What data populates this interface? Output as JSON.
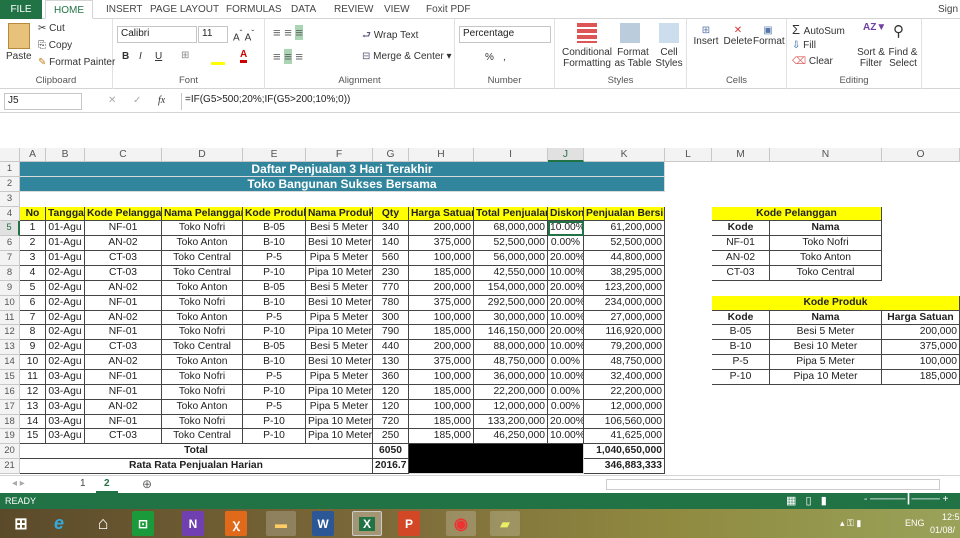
{
  "ribbon": {
    "tabs": [
      "FILE",
      "HOME",
      "INSERT",
      "PAGE LAYOUT",
      "FORMULAS",
      "DATA",
      "REVIEW",
      "VIEW",
      "Foxit PDF"
    ],
    "signin": "Sign",
    "clipboard": {
      "paste": "Paste",
      "cut": "Cut",
      "copy": "Copy",
      "format_painter": "Format Painter",
      "label": "Clipboard"
    },
    "font": {
      "name": "Calibri",
      "size": "11",
      "bold": "B",
      "italic": "I",
      "underline": "U",
      "label": "Font"
    },
    "alignment": {
      "wrap": "Wrap Text",
      "merge": "Merge & Center",
      "label": "Alignment"
    },
    "number": {
      "format": "Percentage",
      "percent": "%",
      "comma": ",",
      "label": "Number"
    },
    "styles": {
      "conditional": "Conditional Formatting",
      "format_table": "Format as Table",
      "cell_styles": "Cell Styles",
      "label": "Styles"
    },
    "cells": {
      "insert": "Insert",
      "delete": "Delete",
      "format": "Format",
      "label": "Cells"
    },
    "editing": {
      "autosum": "AutoSum",
      "fill": "Fill",
      "clear": "Clear",
      "sort": "Sort & Filter",
      "find": "Find & Select",
      "label": "Editing"
    }
  },
  "formula_bar": {
    "name_box": "J5",
    "formula": "=IF(G5>500;20%;IF(G5>200;10%;0))"
  },
  "columns": [
    "A",
    "B",
    "C",
    "D",
    "E",
    "F",
    "G",
    "H",
    "I",
    "J",
    "K",
    "L",
    "M",
    "N",
    "O"
  ],
  "row_numbers": [
    "1",
    "2",
    "3",
    "4",
    "5",
    "6",
    "7",
    "8",
    "9",
    "10",
    "11",
    "12",
    "13",
    "14",
    "15",
    "16",
    "17",
    "18",
    "19",
    "20",
    "21"
  ],
  "title": {
    "line1": "Daftar Penjualan 3 Hari Terakhir",
    "line2": "Toko Bangunan Sukses Bersama"
  },
  "main_table": {
    "headers": [
      "No",
      "Tanggal",
      "Kode Pelanggan",
      "Nama Pelanggan",
      "Kode Produk",
      "Nama Produk",
      "Qty",
      "Harga Satuan",
      "Total Penjualan",
      "Diskon",
      "Penjualan Bersih"
    ],
    "rows": [
      [
        "1",
        "01-Agu",
        "NF-01",
        "Toko Nofri",
        "B-05",
        "Besi 5 Meter",
        "340",
        "200,000",
        "68,000,000",
        "10.00%",
        "61,200,000"
      ],
      [
        "2",
        "01-Agu",
        "AN-02",
        "Toko Anton",
        "B-10",
        "Besi 10 Meter",
        "140",
        "375,000",
        "52,500,000",
        "0.00%",
        "52,500,000"
      ],
      [
        "3",
        "01-Agu",
        "CT-03",
        "Toko Central",
        "P-5",
        "Pipa 5 Meter",
        "560",
        "100,000",
        "56,000,000",
        "20.00%",
        "44,800,000"
      ],
      [
        "4",
        "02-Agu",
        "CT-03",
        "Toko Central",
        "P-10",
        "Pipa 10 Meter",
        "230",
        "185,000",
        "42,550,000",
        "10.00%",
        "38,295,000"
      ],
      [
        "5",
        "02-Agu",
        "AN-02",
        "Toko Anton",
        "B-05",
        "Besi 5 Meter",
        "770",
        "200,000",
        "154,000,000",
        "20.00%",
        "123,200,000"
      ],
      [
        "6",
        "02-Agu",
        "NF-01",
        "Toko Nofri",
        "B-10",
        "Besi 10 Meter",
        "780",
        "375,000",
        "292,500,000",
        "20.00%",
        "234,000,000"
      ],
      [
        "7",
        "02-Agu",
        "AN-02",
        "Toko Anton",
        "P-5",
        "Pipa 5 Meter",
        "300",
        "100,000",
        "30,000,000",
        "10.00%",
        "27,000,000"
      ],
      [
        "8",
        "02-Agu",
        "NF-01",
        "Toko Nofri",
        "P-10",
        "Pipa 10 Meter",
        "790",
        "185,000",
        "146,150,000",
        "20.00%",
        "116,920,000"
      ],
      [
        "9",
        "02-Agu",
        "CT-03",
        "Toko Central",
        "B-05",
        "Besi 5 Meter",
        "440",
        "200,000",
        "88,000,000",
        "10.00%",
        "79,200,000"
      ],
      [
        "10",
        "02-Agu",
        "AN-02",
        "Toko Anton",
        "B-10",
        "Besi 10 Meter",
        "130",
        "375,000",
        "48,750,000",
        "0.00%",
        "48,750,000"
      ],
      [
        "11",
        "03-Agu",
        "NF-01",
        "Toko Nofri",
        "P-5",
        "Pipa 5 Meter",
        "360",
        "100,000",
        "36,000,000",
        "10.00%",
        "32,400,000"
      ],
      [
        "12",
        "03-Agu",
        "NF-01",
        "Toko Nofri",
        "P-10",
        "Pipa 10 Meter",
        "120",
        "185,000",
        "22,200,000",
        "0.00%",
        "22,200,000"
      ],
      [
        "13",
        "03-Agu",
        "AN-02",
        "Toko Anton",
        "P-5",
        "Pipa 5 Meter",
        "120",
        "100,000",
        "12,000,000",
        "0.00%",
        "12,000,000"
      ],
      [
        "14",
        "03-Agu",
        "NF-01",
        "Toko Nofri",
        "P-10",
        "Pipa 10 Meter",
        "720",
        "185,000",
        "133,200,000",
        "20.00%",
        "106,560,000"
      ],
      [
        "15",
        "03-Agu",
        "CT-03",
        "Toko Central",
        "P-10",
        "Pipa 10 Meter",
        "250",
        "185,000",
        "46,250,000",
        "10.00%",
        "41,625,000"
      ]
    ],
    "total": {
      "label": "Total",
      "qty": "6050",
      "bersih": "1,040,650,000"
    },
    "average": {
      "label": "Rata Rata Penjualan Harian",
      "qty": "2016.7",
      "bersih": "346,883,333"
    }
  },
  "lookup_pelanggan": {
    "title": "Kode Pelanggan",
    "headers": [
      "Kode",
      "Nama"
    ],
    "rows": [
      [
        "NF-01",
        "Toko Nofri"
      ],
      [
        "AN-02",
        "Toko Anton"
      ],
      [
        "CT-03",
        "Toko Central"
      ]
    ]
  },
  "lookup_produk": {
    "title": "Kode Produk",
    "headers": [
      "Kode",
      "Nama",
      "Harga Satuan"
    ],
    "rows": [
      [
        "B-05",
        "Besi 5 Meter",
        "200,000"
      ],
      [
        "B-10",
        "Besi 10 Meter",
        "375,000"
      ],
      [
        "P-5",
        "Pipa 5 Meter",
        "100,000"
      ],
      [
        "P-10",
        "Pipa 10 Meter",
        "185,000"
      ]
    ]
  },
  "sheet_tabs": [
    "1",
    "2"
  ],
  "status": {
    "ready": "READY"
  },
  "taskbar": {
    "lang": "ENG",
    "time": "12:5",
    "date": "01/08/"
  }
}
